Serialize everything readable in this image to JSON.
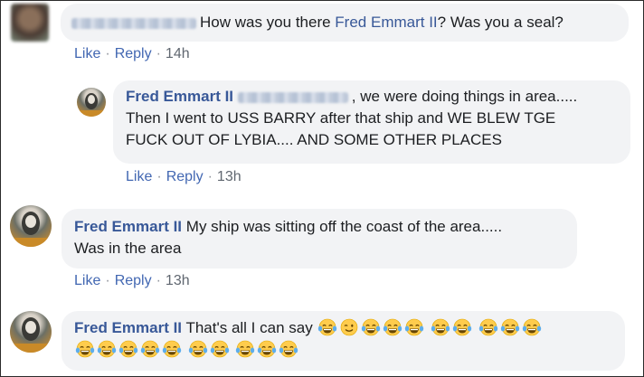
{
  "comments": [
    {
      "text_pre": "How was you there ",
      "mention": "Fred Emmart II",
      "text_post": "? Was you a seal?",
      "actions": {
        "like": "Like",
        "reply": "Reply",
        "time": "14h"
      }
    },
    {
      "name": "Fred Emmart II",
      "line1": ", we were doing things in area.....",
      "line2": "Then I went to USS BARRY after that ship and WE BLEW TGE",
      "line3": "FUCK OUT OF LYBIA.... AND SOME OTHER PLACES",
      "actions": {
        "like": "Like",
        "reply": "Reply",
        "time": "13h"
      }
    },
    {
      "name": "Fred Emmart II",
      "line1": "My ship was sitting off the coast of the area.....",
      "line2": "Was in the area",
      "actions": {
        "like": "Like",
        "reply": "Reply",
        "time": "13h"
      }
    },
    {
      "name": "Fred Emmart II",
      "line1": "That's all I can say",
      "emoji_row1": [
        "joy-emoji",
        "wink-emoji",
        "joy-emoji",
        "joy-emoji",
        "joy-emoji",
        "joy-emoji",
        "joy-emoji",
        "joy-emoji",
        "joy-emoji",
        "joy-emoji"
      ],
      "emoji_row2": [
        "joy-emoji",
        "joy-emoji",
        "joy-emoji",
        "joy-emoji",
        "joy-emoji",
        "joy-emoji",
        "joy-emoji",
        "joy-emoji",
        "joy-emoji",
        "joy-emoji"
      ]
    }
  ],
  "colors": {
    "link": "#385898",
    "bubble": "#f2f3f5",
    "meta": "#606770"
  }
}
